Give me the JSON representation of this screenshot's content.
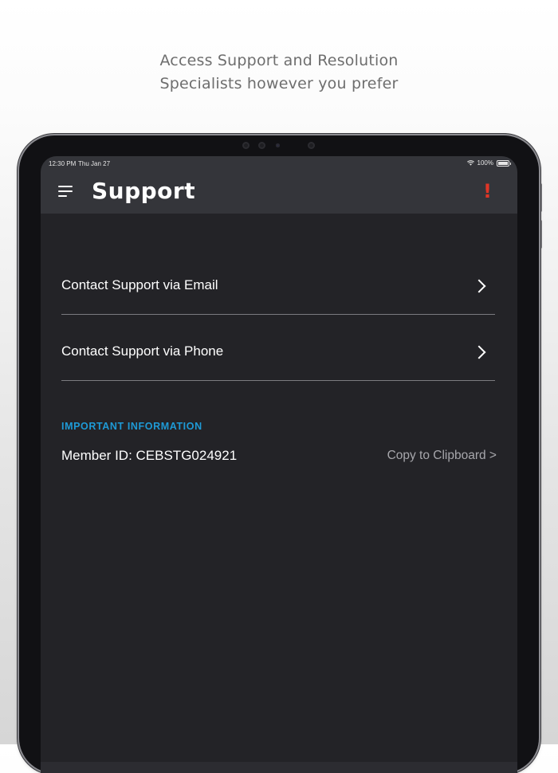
{
  "caption": {
    "line1": "Access Support and Resolution",
    "line2": "Specialists however you prefer"
  },
  "status_bar": {
    "time": "12:30 PM",
    "date": "Thu Jan 27",
    "battery": "100%",
    "wifi_icon": "wifi-icon",
    "battery_icon": "battery-icon"
  },
  "nav": {
    "title": "Support",
    "menu_icon": "hamburger-menu-icon",
    "alert_icon": "exclamation-alert-icon",
    "alert_glyph": "!"
  },
  "rows": [
    {
      "label": "Contact Support via Email",
      "icon": "chevron-right-icon"
    },
    {
      "label": "Contact Support via Phone",
      "icon": "chevron-right-icon"
    }
  ],
  "info": {
    "heading": "IMPORTANT INFORMATION",
    "member_id": "Member ID: CEBSTG024921",
    "copy_label": "Copy to Clipboard >"
  },
  "colors": {
    "accent": "#1e9ad6",
    "alert": "#e03526",
    "background": "#232327",
    "navbar": "#34353a"
  }
}
